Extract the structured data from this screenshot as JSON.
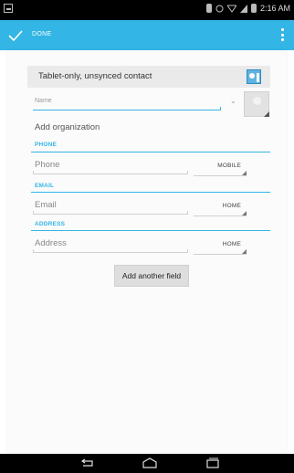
{
  "status_bar": {
    "time": "2:16 AM"
  },
  "action_bar": {
    "done_label": "DONE"
  },
  "account": {
    "label": "Tablet-only, unsynced contact"
  },
  "name": {
    "placeholder": "Name"
  },
  "organization": {
    "placeholder": "Add organization"
  },
  "phone": {
    "section_label": "PHONE",
    "placeholder": "Phone",
    "type": "MOBILE"
  },
  "email": {
    "section_label": "EMAIL",
    "placeholder": "Email",
    "type": "HOME"
  },
  "address": {
    "section_label": "ADDRESS",
    "placeholder": "Address",
    "type": "HOME"
  },
  "add_field_button": "Add another field",
  "colors": {
    "accent": "#33b5e5",
    "status_bar": "#000000",
    "card": "#fbfbfb"
  }
}
